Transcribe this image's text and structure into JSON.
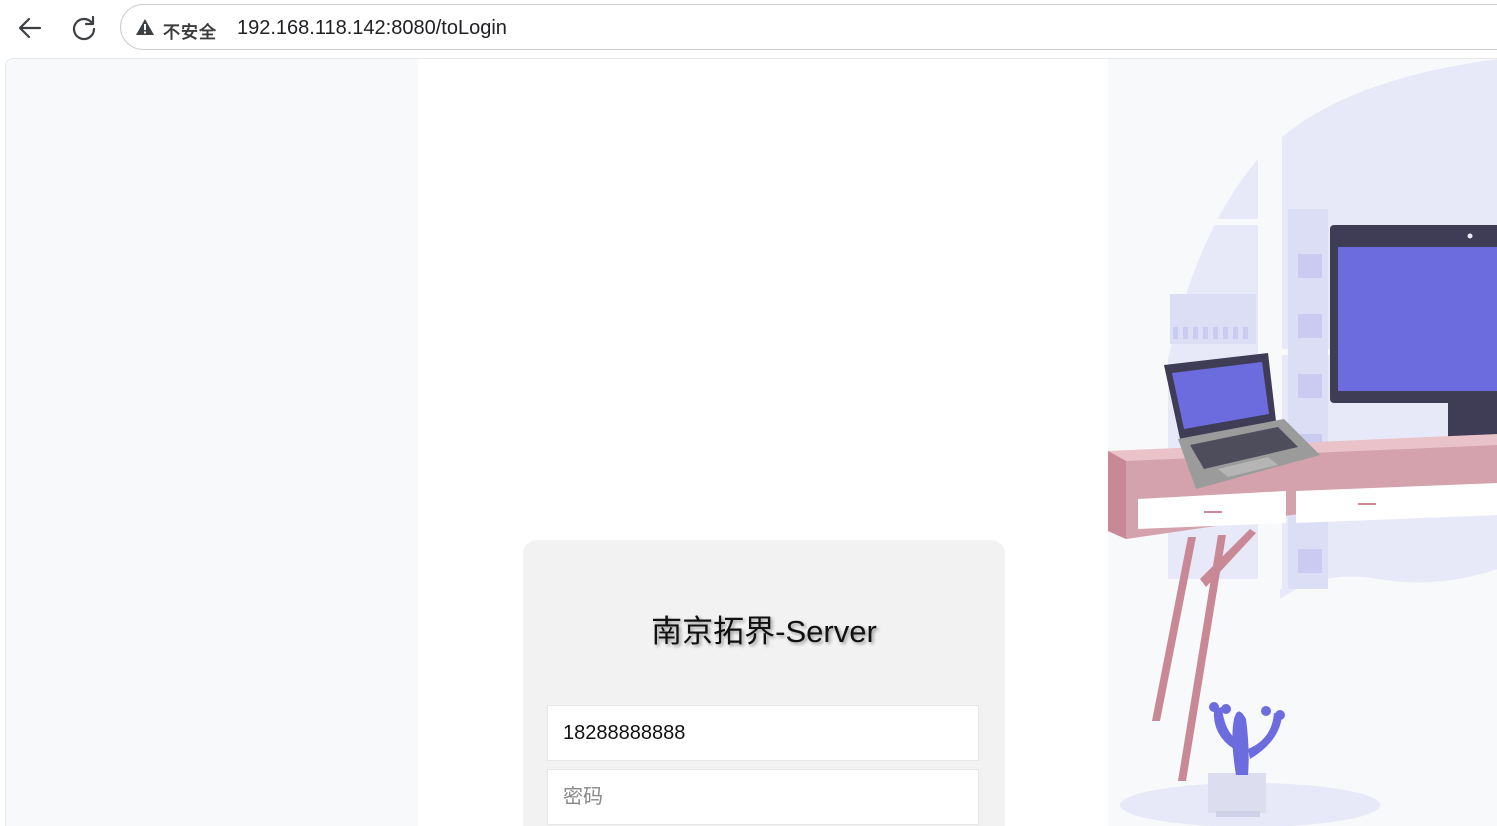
{
  "browser": {
    "security_label": "不安全",
    "url": "192.168.118.142:8080/toLogin"
  },
  "login": {
    "title": "南京拓界-Server",
    "username_value": "18288888888",
    "password_placeholder": "密码"
  },
  "icons": {
    "back": "arrow-left-icon",
    "reload": "reload-icon",
    "security": "warning-triangle-icon"
  },
  "colors": {
    "accent_purple": "#6c6cdf",
    "desk_pink": "#e9c3c9",
    "desk_leg": "#c98896",
    "monitor_frame": "#3f3d56"
  }
}
